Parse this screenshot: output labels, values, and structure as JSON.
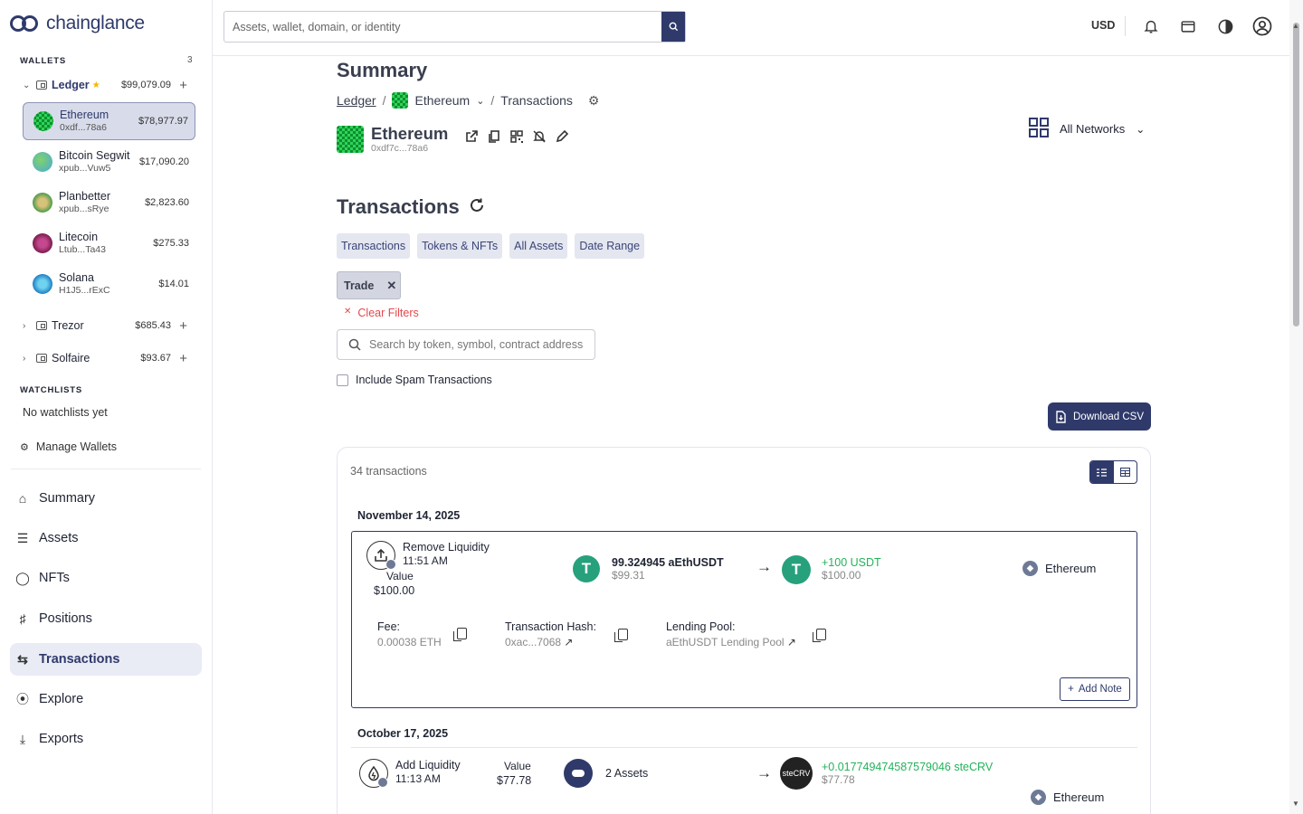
{
  "brand": {
    "name": "chainglance"
  },
  "sidebar": {
    "wallets_title": "WALLETS",
    "wallets_count": "3",
    "groups": [
      {
        "name": "Ledger",
        "value": "$99,079.09",
        "starred": true
      },
      {
        "name": "Trezor",
        "value": "$685.43"
      },
      {
        "name": "Solfaire",
        "value": "$93.67"
      }
    ],
    "wallets": [
      {
        "name": "Ethereum",
        "address": "0xdf...78a6",
        "value": "$78,977.97"
      },
      {
        "name": "Bitcoin Segwit",
        "address": "xpub...Vuw5",
        "value": "$17,090.20"
      },
      {
        "name": "Planbetter",
        "address": "xpub...sRye",
        "value": "$2,823.60"
      },
      {
        "name": "Litecoin",
        "address": "Ltub...Ta43",
        "value": "$275.33"
      },
      {
        "name": "Solana",
        "address": "H1J5...rExC",
        "value": "$14.01"
      }
    ],
    "watchlists_title": "WATCHLISTS",
    "no_watchlists": "No watchlists yet",
    "manage_wallets": "Manage Wallets",
    "nav": [
      {
        "label": "Summary",
        "icon": "home-icon"
      },
      {
        "label": "Assets",
        "icon": "database-icon"
      },
      {
        "label": "NFTs",
        "icon": "nft-icon"
      },
      {
        "label": "Positions",
        "icon": "hierarchy-icon"
      },
      {
        "label": "Transactions",
        "icon": "swap-icon",
        "active": true
      },
      {
        "label": "Explore",
        "icon": "compass-icon"
      },
      {
        "label": "Exports",
        "icon": "download-icon"
      }
    ]
  },
  "topbar": {
    "search_placeholder": "Assets, wallet, domain, or identity",
    "currency": "USD"
  },
  "page": {
    "title": "Summary",
    "breadcrumb": {
      "root": "Ledger",
      "network": "Ethereum",
      "current": "Transactions"
    },
    "account": {
      "name": "Ethereum",
      "address": "0xdf7c...78a6"
    },
    "networks_label": "All Networks",
    "tx_title": "Transactions",
    "filter_chips": [
      "Transactions",
      "Tokens & NFTs",
      "All Assets",
      "Date Range"
    ],
    "active_filter": "Trade",
    "clear_filters": "Clear Filters",
    "token_search_placeholder": "Search by token, symbol, contract address",
    "include_spam": "Include Spam Transactions",
    "download_csv": "Download CSV",
    "tx_count": "34 transactions"
  },
  "transactions": [
    {
      "date": "November 14, 2025",
      "type": "Remove Liquidity",
      "time": "11:51 AM",
      "value_label": "Value",
      "value": "$100.00",
      "sent_amount": "99.324945 aEthUSDT",
      "sent_usd": "$99.31",
      "recv_amount": "+100 USDT",
      "recv_usd": "$100.00",
      "network": "Ethereum",
      "fee_label": "Fee:",
      "fee": "0.00038 ETH",
      "hash_label": "Transaction Hash:",
      "hash": "0xac...7068",
      "pool_label": "Lending Pool:",
      "pool": "aEthUSDT Lending Pool",
      "add_note": "Add Note"
    },
    {
      "date": "October 17, 2025",
      "type": "Add Liquidity",
      "time": "11:13 AM",
      "value_label": "Value",
      "value": "$77.78",
      "sent_amount": "2 Assets",
      "recv_amount": "+0.017749474587579046 steCRV",
      "recv_usd": "$77.78",
      "recv_token_label": "steCRV",
      "network": "Ethereum"
    }
  ]
}
